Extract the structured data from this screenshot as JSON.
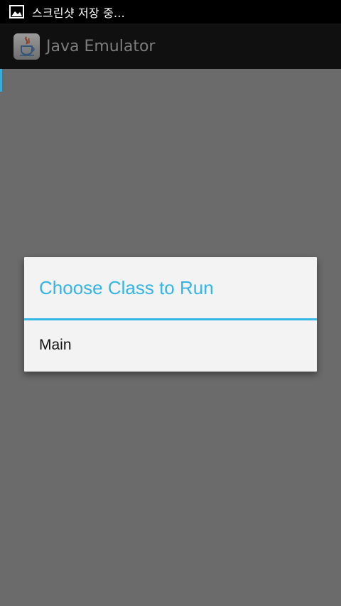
{
  "status_bar": {
    "icon": "image-icon",
    "notification_text": "스크린샷 저장 중..."
  },
  "action_bar": {
    "app_icon": "java-cup-icon",
    "title": "Java Emulator"
  },
  "dialog": {
    "title": "Choose Class to Run",
    "items": [
      "Main"
    ]
  },
  "colors": {
    "accent": "#33b5e5",
    "background_dim": "#6b6b6b",
    "dialog_bg": "#f3f3f3",
    "status_bar_bg": "#000000",
    "action_bar_bg": "#101010"
  }
}
